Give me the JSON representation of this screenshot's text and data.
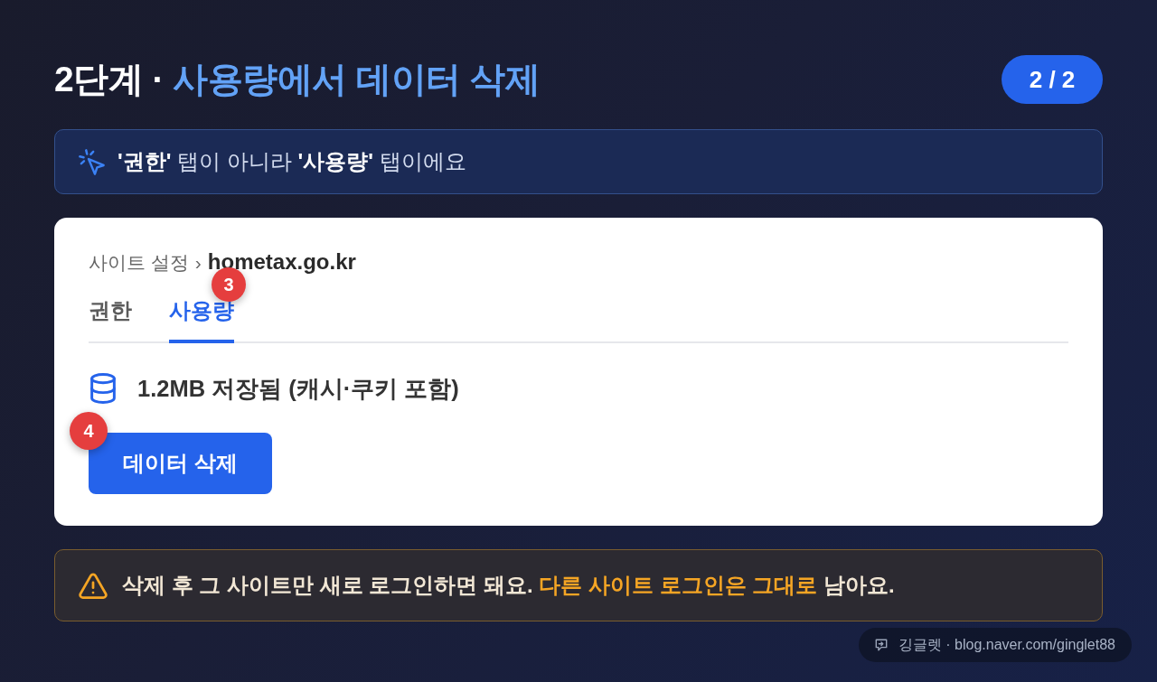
{
  "header": {
    "title": [
      {
        "text": "2단계 · ",
        "highlight": false
      },
      {
        "text": "사용량에서 데이터 삭제",
        "highlight": true
      }
    ],
    "progress": "2 / 2"
  },
  "tip": {
    "text": "**'권한'** 탭이 아니라 **'사용량'** 탭이에요"
  },
  "site_panel": {
    "breadcrumb": {
      "parent": "사이트 설정",
      "separator": "›",
      "current": "hometax.go.kr"
    },
    "tabs": [
      {
        "label": "권한",
        "selected": false
      },
      {
        "label": "사용량",
        "selected": true,
        "step": "3"
      }
    ],
    "storage": "1.2MB 저장됨 (캐시·쿠키 포함)",
    "button": {
      "label": "데이터 삭제",
      "step": "4"
    }
  },
  "warning": {
    "segments": [
      {
        "text": "삭제 후 그 사이트만 새로 로그인하면 돼요. ",
        "highlight": false
      },
      {
        "text": "다른 사이트 로그인은 그대로",
        "highlight": true
      },
      {
        "text": " 남아요.",
        "highlight": false
      }
    ]
  },
  "credit": "깅글렛 · blog.naver.com/ginglet88"
}
